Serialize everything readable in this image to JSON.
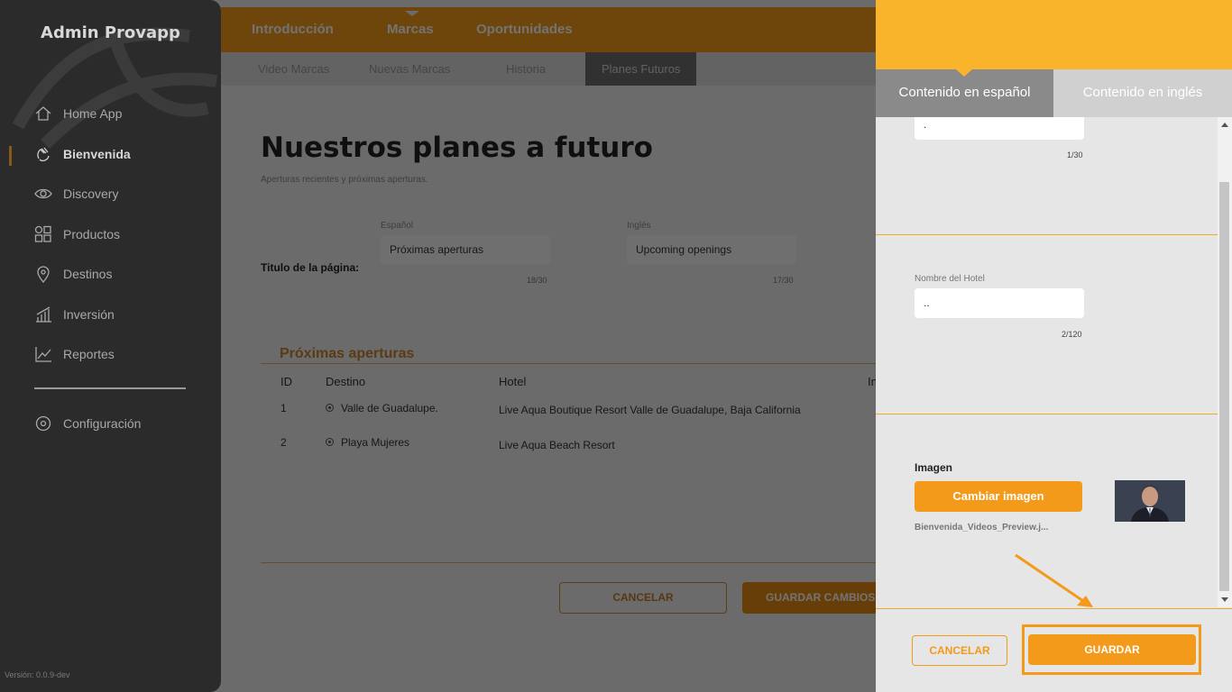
{
  "sidebar": {
    "brand": "Admin Provapp",
    "items": [
      {
        "label": "Home App",
        "icon": "home-icon"
      },
      {
        "label": "Bienvenida",
        "icon": "waving-hand-icon",
        "active": true
      },
      {
        "label": "Discovery",
        "icon": "eye-icon"
      },
      {
        "label": "Productos",
        "icon": "grid-icon"
      },
      {
        "label": "Destinos",
        "icon": "location-pin-icon"
      },
      {
        "label": "Inversión",
        "icon": "bar-chart-icon"
      },
      {
        "label": "Reportes",
        "icon": "line-chart-icon"
      }
    ],
    "settings": {
      "label": "Configuración",
      "icon": "gear-icon"
    },
    "version": "Versión: 0.0.9-dev"
  },
  "topnav": {
    "tabs": [
      "Introducción",
      "Marcas",
      "Oportunidades"
    ],
    "active": "Marcas"
  },
  "subnav": {
    "tabs": [
      "Video Marcas",
      "Nuevas Marcas",
      "Historia",
      "Planes Futuros"
    ],
    "active": "Planes Futuros"
  },
  "page": {
    "title": "Nuestros planes a futuro",
    "subtitle": "Aperturas recientes y próximas aperturas.",
    "title_label": "Titulo de la página:",
    "spanish_heading": "Español",
    "english_heading": "Inglés",
    "spanish_value": "Próximas aperturas",
    "english_value": "Upcoming openings",
    "spanish_counter": "18/30",
    "english_counter": "17/30",
    "section_title": "Próximas aperturas",
    "table": {
      "headers": [
        "ID",
        "Destino",
        "Hotel",
        "In"
      ],
      "rows": [
        {
          "id": "1",
          "destino": "Valle de Guadalupe.",
          "hotel": "Live Aqua Boutique Resort Valle de Guadalupe, Baja California"
        },
        {
          "id": "2",
          "destino": "Playa Mujeres",
          "hotel": "Live Aqua Beach Resort"
        }
      ]
    },
    "cancel_label": "CANCELAR",
    "save_label": "GUARDAR CAMBIOS"
  },
  "panel": {
    "tab_es": "Contenido en español",
    "tab_en": "Contenido en inglés",
    "field1_value": ".",
    "field1_counter": "1/30",
    "hotel_label": "Nombre del Hotel",
    "hotel_value": "..",
    "hotel_counter": "2/120",
    "image_label": "Imagen",
    "change_image": "Cambiar imagen",
    "filename": "Bienvenida_Videos_Preview.j...",
    "cancel": "CANCELAR",
    "save": "GUARDAR"
  },
  "colors": {
    "accent": "#f39a1a",
    "panel_header": "#f9b42b",
    "sidebar_bg": "#2b2b2b"
  }
}
